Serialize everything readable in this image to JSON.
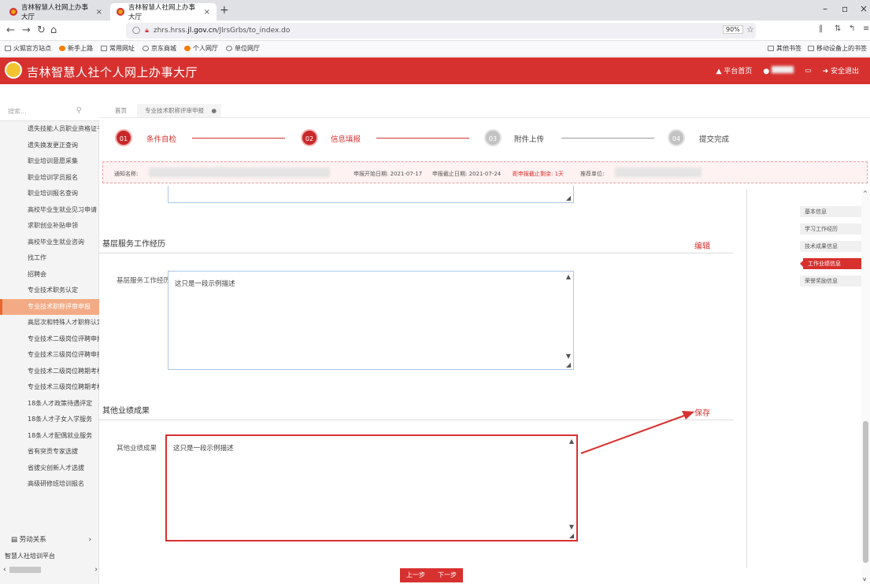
{
  "browser": {
    "tabs": [
      {
        "label": "吉林智慧人社网上办事大厅"
      },
      {
        "label": "吉林智慧人社网上办事大厅"
      }
    ],
    "url_prefix": "zhrs.hrss.",
    "url_domain": "jl.gov.cn",
    "url_path": "/JlrsGrbs/to_index.do",
    "zoom": "90%",
    "bookmarks": [
      "火狐官方站点",
      "新手上路",
      "常用网址",
      "京东商城",
      "个人网厅",
      "单位网厅"
    ],
    "bookmarks_right": [
      "其他书签",
      "移动设备上的书签"
    ]
  },
  "header": {
    "title": "吉林智慧人社个人网上办事大厅",
    "home": "平台首页",
    "logout": "安全退出"
  },
  "sidebar": {
    "search_placeholder": "搜索...",
    "items": [
      "遗失技能人员职业资格证书",
      "遗失换发更正查询",
      "职业培训意愿采集",
      "职业培训学员报名",
      "职业培训报名查询",
      "高校毕业生就业见习申请",
      "求职创业补贴申领",
      "高校毕业生就业咨询",
      "找工作",
      "招聘会",
      "专业技术职务认定",
      "专业技术职称评审申报",
      "高层次和特殊人才职称认定",
      "专业技术二级岗位评聘申报",
      "专业技术三级岗位评聘申报",
      "专业技术二级岗位聘期考核",
      "专业技术三级岗位聘期考核",
      "18条人才政策待遇评定",
      "18条人才子女入学服务",
      "18条人才配偶就业服务",
      "省有突贡专家选拔",
      "省拔尖创新人才选拔",
      "高级研修班培训报名"
    ],
    "active_index": 11,
    "group": "劳动关系",
    "bottom": "智慧人社培训平台"
  },
  "page_tabs": [
    "首页",
    "专业技术职称评审申报"
  ],
  "steps": [
    {
      "num": "01",
      "label": "条件自检"
    },
    {
      "num": "02",
      "label": "信息填报"
    },
    {
      "num": "03",
      "label": "附件上传"
    },
    {
      "num": "04",
      "label": "提交完成"
    }
  ],
  "notice": {
    "name_label": "通知名称:",
    "start": "申报开始日期: 2021-07-17",
    "end": "申报截止日期: 2021-07-24",
    "remaining": "距申报截止剩余: 1天",
    "unit_label": "推荐单位:"
  },
  "section1": {
    "title": "基层服务工作经历",
    "action": "编辑",
    "field_label": "基层服务工作经历",
    "value": "这只是一段示例描述"
  },
  "section2": {
    "title": "其他业绩成果",
    "action": "保存",
    "field_label": "其他业绩成果",
    "value": "这只是一段示例描述"
  },
  "right_nav": [
    "基本信息",
    "学习工作经历",
    "技术成果信息",
    "工作业绩信息",
    "荣誉奖励信息"
  ],
  "right_nav_active": 3,
  "buttons": {
    "prev": "上一步",
    "next": "下一步"
  },
  "colors": {
    "brand": "#d7312f",
    "active_menu": "#f3ab86"
  }
}
